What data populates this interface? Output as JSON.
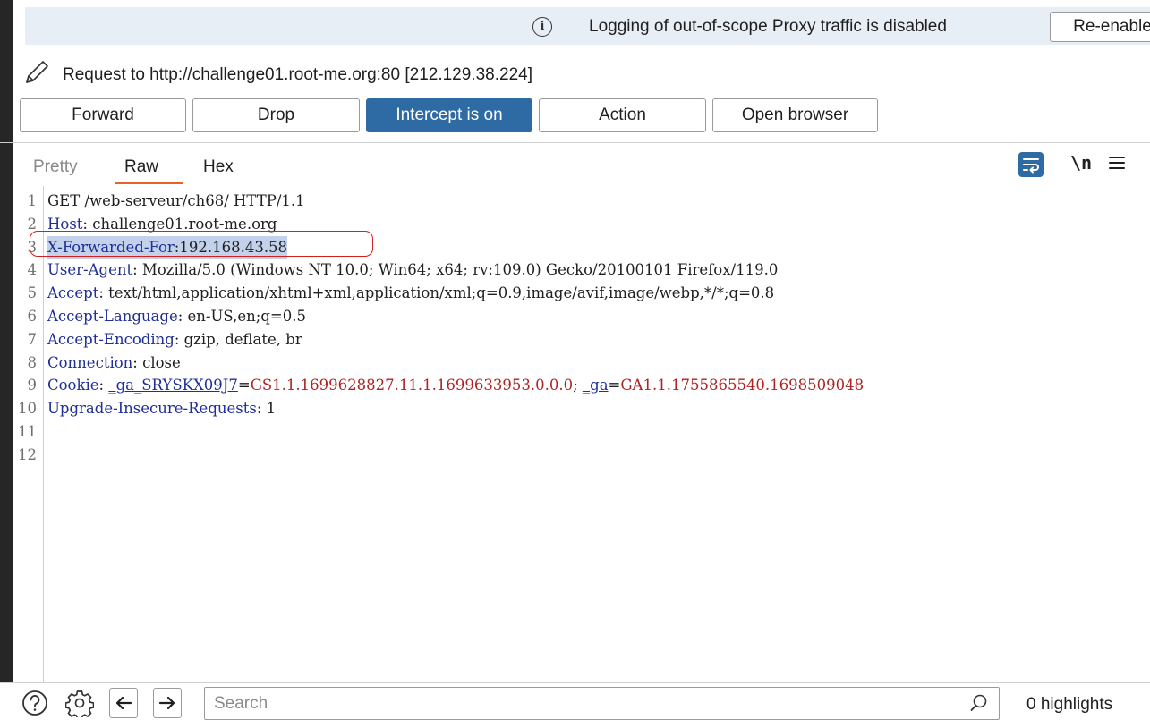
{
  "banner": {
    "info_icon": "info-icon",
    "message": "Logging of out-of-scope Proxy traffic is disabled",
    "button_label": "Re-enable"
  },
  "request": {
    "edit_icon": "pencil-icon",
    "title": "Request to http://challenge01.root-me.org:80  [212.129.38.224]"
  },
  "toolbar": {
    "forward": "Forward",
    "drop": "Drop",
    "intercept": "Intercept is on",
    "action": "Action",
    "open_browser": "Open browser",
    "accent_color": "#2e6aa3"
  },
  "tabs": [
    {
      "label": "Pretty",
      "active": false
    },
    {
      "label": "Raw",
      "active": true
    },
    {
      "label": "Hex",
      "active": false
    }
  ],
  "editor_icons": {
    "wrap": "word-wrap-icon",
    "newline": "\\n",
    "menu": "hamburger-menu-icon"
  },
  "editor": {
    "lines": [
      {
        "n": "1",
        "key": "",
        "sep": "",
        "value": "GET /web-serveur/ch68/ HTTP/1.1"
      },
      {
        "n": "2",
        "key": "Host",
        "sep": ": ",
        "value": "challenge01.root-me.org"
      },
      {
        "n": "3",
        "key": "X-Forwarded-For",
        "sep": ":",
        "value": "192.168.43.58",
        "selected": true
      },
      {
        "n": "4",
        "key": "User-Agent",
        "sep": ": ",
        "value": "Mozilla/5.0 (Windows NT 10.0; Win64; x64; rv:109.0) Gecko/20100101 Firefox/119.0"
      },
      {
        "n": "5",
        "key": "Accept",
        "sep": ": ",
        "value": "text/html,application/xhtml+xml,application/xml;q=0.9,image/avif,image/webp,*/*;q=0.8"
      },
      {
        "n": "6",
        "key": "Accept-Language",
        "sep": ": ",
        "value": "en-US,en;q=0.5"
      },
      {
        "n": "7",
        "key": "Accept-Encoding",
        "sep": ": ",
        "value": "gzip, deflate, br"
      },
      {
        "n": "8",
        "key": "Connection",
        "sep": ": ",
        "value": "close"
      },
      {
        "n": "9",
        "key": "Cookie",
        "sep": ": ",
        "cookies": [
          {
            "name": "_ga_SRYSKX09J7",
            "value": "GS1.1.1699628827.11.1.1699633953.0.0.0"
          },
          {
            "name": "_ga",
            "value": "GA1.1.1755865540.1698509048"
          }
        ]
      },
      {
        "n": "10",
        "key": "Upgrade-Insecure-Requests",
        "sep": ": ",
        "value": "1"
      },
      {
        "n": "11",
        "key": "",
        "sep": "",
        "value": ""
      },
      {
        "n": "12",
        "key": "",
        "sep": "",
        "value": ""
      }
    ],
    "header_key_color": "#1f2f96",
    "cookie_value_color": "#b02323",
    "annotation_color": "#d02020"
  },
  "bottom": {
    "search_placeholder": "Search",
    "highlights": "0 highlights"
  }
}
